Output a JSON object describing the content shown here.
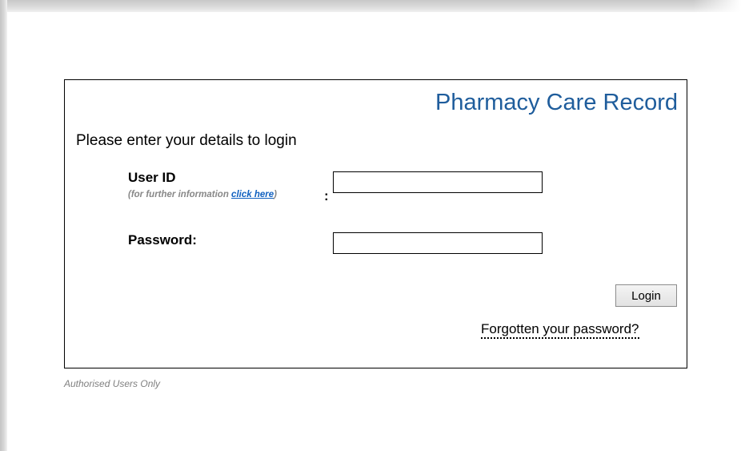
{
  "app": {
    "title": "Pharmacy Care Record"
  },
  "form": {
    "intro": "Please enter your details to login",
    "userid": {
      "label": "User ID",
      "hint_prefix": "(for further information ",
      "hint_link": "click here",
      "hint_suffix": ")",
      "colon": ":",
      "value": "",
      "placeholder": ""
    },
    "password": {
      "label": "Password:",
      "value": "",
      "placeholder": ""
    },
    "login_button": "Login",
    "forgot_link": "Forgotten your password?"
  },
  "footer": {
    "note": "Authorised Users Only"
  },
  "colors": {
    "title": "#1f5d9c",
    "link": "#1060c0",
    "hint": "#888888",
    "footer": "#808080"
  }
}
